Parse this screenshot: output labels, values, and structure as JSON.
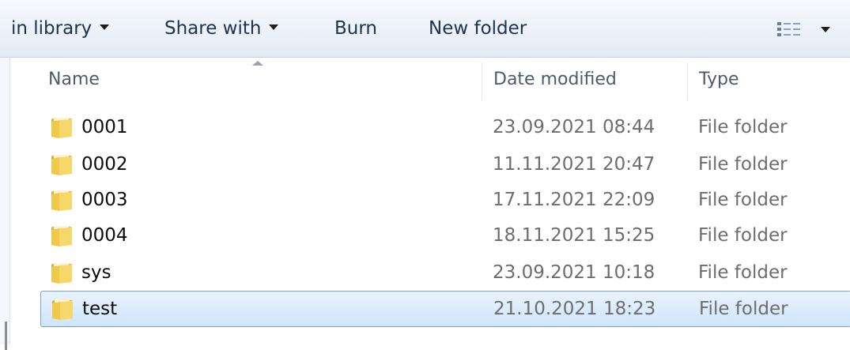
{
  "toolbar": {
    "include_in_library": "in library",
    "share_with": "Share with",
    "burn": "Burn",
    "new_folder": "New folder"
  },
  "columns": {
    "name": "Name",
    "date_modified": "Date modified",
    "type": "Type"
  },
  "rows": [
    {
      "name": "0001",
      "date": "23.09.2021 08:44",
      "type": "File folder",
      "selected": false
    },
    {
      "name": "0002",
      "date": "11.11.2021 20:47",
      "type": "File folder",
      "selected": false
    },
    {
      "name": "0003",
      "date": "17.11.2021 22:09",
      "type": "File folder",
      "selected": false
    },
    {
      "name": "0004",
      "date": "18.11.2021 15:25",
      "type": "File folder",
      "selected": false
    },
    {
      "name": "sys",
      "date": "23.09.2021 10:18",
      "type": "File folder",
      "selected": false
    },
    {
      "name": "test",
      "date": "21.10.2021 18:23",
      "type": "File folder",
      "selected": true
    }
  ],
  "icons": {
    "folder": "folder-icon",
    "views": "views-icon",
    "dropdown": "chevron-down-icon",
    "sort": "sort-ascending-icon"
  },
  "colors": {
    "selection_border": "#7da2ce",
    "selection_fill": "#cfe4fb",
    "toolbar_bg": "#e9eff8",
    "folder": "#f0c84a"
  }
}
